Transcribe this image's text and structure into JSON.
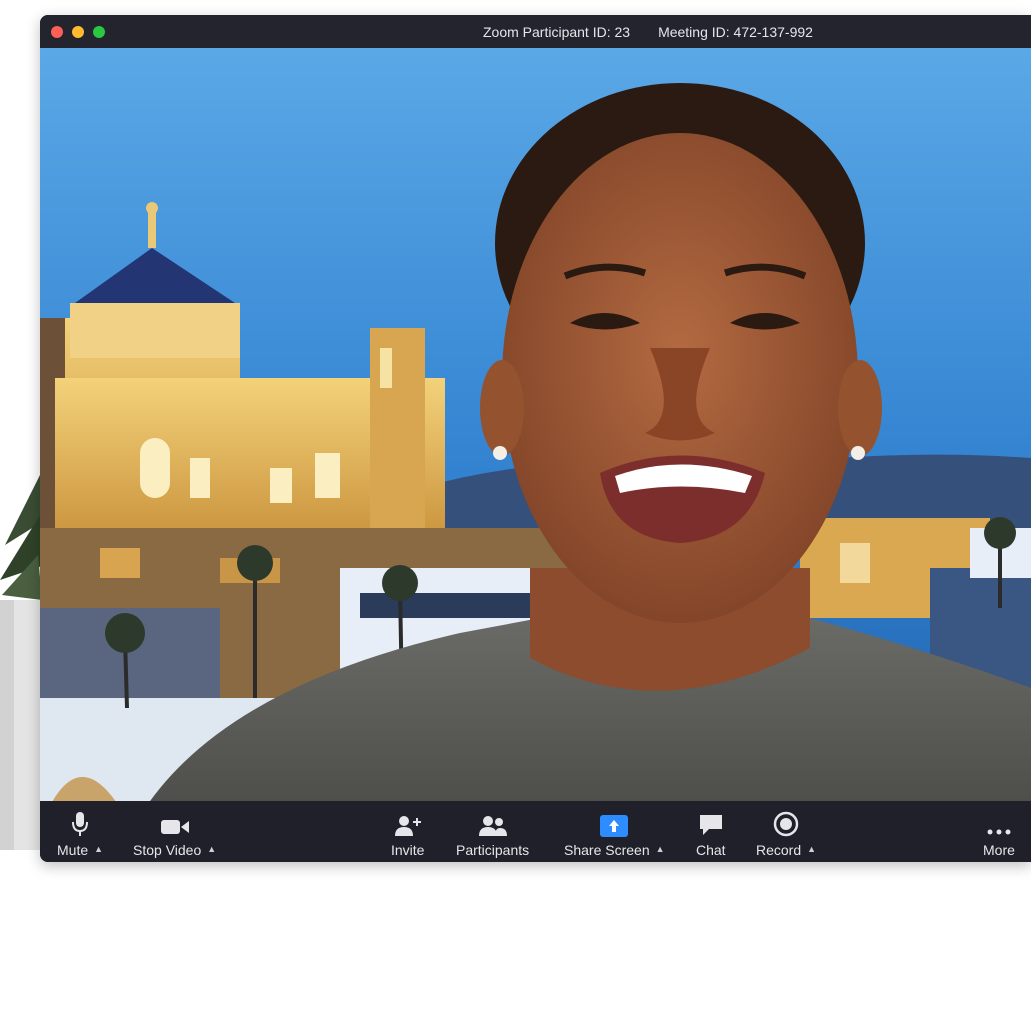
{
  "window": {
    "participant_id": "Zoom Participant ID: 23",
    "meeting_id": "Meeting ID: 472-137-992"
  },
  "toolbar": {
    "mute": "Mute",
    "stop_video": "Stop Video",
    "invite": "Invite",
    "participants": "Participants",
    "share_screen": "Share Screen",
    "chat": "Chat",
    "record": "Record",
    "more": "More"
  },
  "icons": {
    "mute": "microphone-icon",
    "stop_video": "video-camera-icon",
    "invite": "add-person-icon",
    "participants": "people-icon",
    "share_screen": "share-screen-icon",
    "chat": "chat-bubble-icon",
    "record": "record-icon",
    "more": "ellipsis-icon"
  },
  "colors": {
    "toolbar_bg": "#1f2029",
    "share_accent": "#2d8cff",
    "sky": "#3b8fd6"
  }
}
